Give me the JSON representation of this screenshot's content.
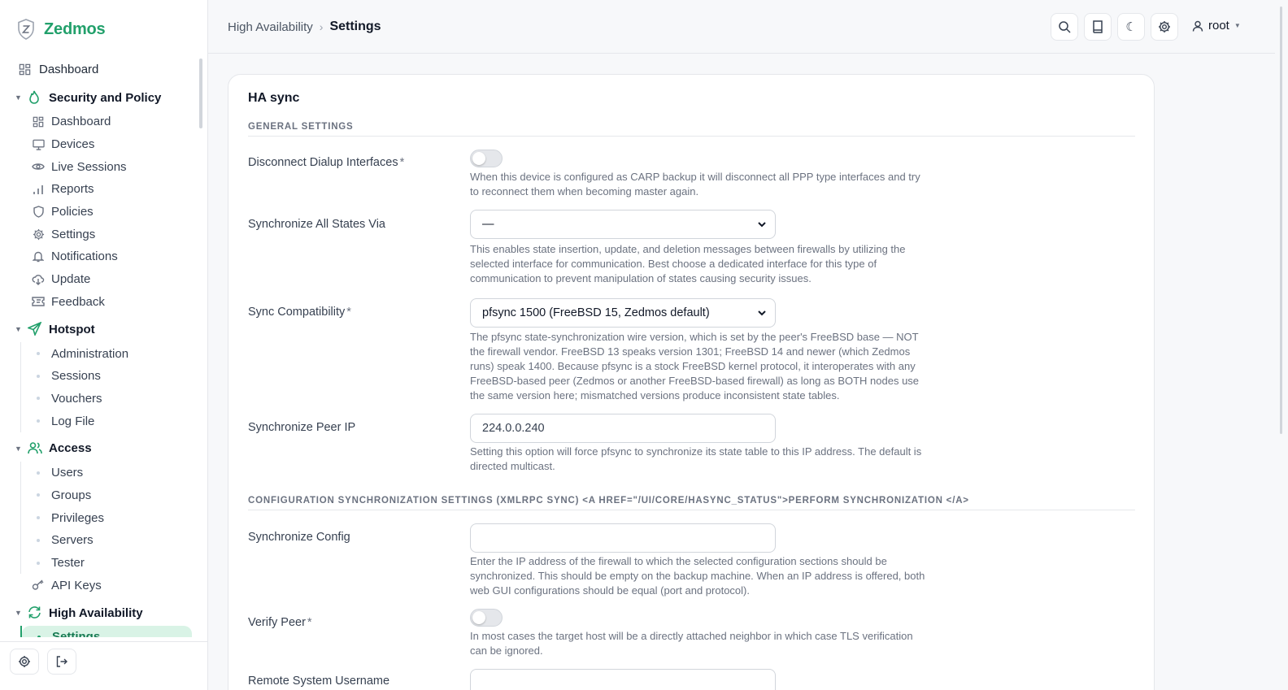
{
  "brand": {
    "name": "Zedmos"
  },
  "sidebar": {
    "top_item": {
      "label": "Dashboard",
      "icon": "grid-icon"
    },
    "groups": [
      {
        "label": "Security and Policy",
        "icon": "flame-icon",
        "items": [
          {
            "label": "Dashboard",
            "icon": "grid-icon"
          },
          {
            "label": "Devices",
            "icon": "monitor-icon"
          },
          {
            "label": "Live Sessions",
            "icon": "eye-icon"
          },
          {
            "label": "Reports",
            "icon": "bar-chart-icon"
          },
          {
            "label": "Policies",
            "icon": "shield-icon"
          },
          {
            "label": "Settings",
            "icon": "gear-icon"
          },
          {
            "label": "Notifications",
            "icon": "bell-icon"
          },
          {
            "label": "Update",
            "icon": "cloud-download-icon"
          },
          {
            "label": "Feedback",
            "icon": "ticket-icon"
          }
        ]
      },
      {
        "label": "Hotspot",
        "icon": "send-icon",
        "items": [
          {
            "label": "Administration"
          },
          {
            "label": "Sessions"
          },
          {
            "label": "Vouchers"
          },
          {
            "label": "Log File"
          }
        ]
      },
      {
        "label": "Access",
        "icon": "users-icon",
        "items": [
          {
            "label": "Users"
          },
          {
            "label": "Groups"
          },
          {
            "label": "Privileges"
          },
          {
            "label": "Servers"
          },
          {
            "label": "Tester"
          },
          {
            "label": "API Keys",
            "icon": "key-icon"
          }
        ]
      },
      {
        "label": "High Availability",
        "icon": "refresh-icon",
        "items": [
          {
            "label": "Settings",
            "active": true
          }
        ]
      }
    ]
  },
  "header": {
    "breadcrumb_parent": "High Availability",
    "breadcrumb_current": "Settings",
    "user": "root"
  },
  "card": {
    "title": "HA sync",
    "general_section": "General Settings",
    "config_section": "Configuration Synchronization Settings (XMLRPC Sync) <a href=\"/ui/core/hasync_status\">Perform synchronization </a>",
    "fields": {
      "disconnect": {
        "label": "Disconnect Dialup Interfaces",
        "required": "*",
        "enabled": false,
        "help": "When this device is configured as CARP backup it will disconnect all PPP type interfaces and try to reconnect them when becoming master again."
      },
      "sync_states": {
        "label": "Synchronize All States Via",
        "value": "—",
        "help": "This enables state insertion, update, and deletion messages between firewalls by utilizing the selected interface for communication. Best choose a dedicated interface for this type of communication to prevent manipulation of states causing security issues."
      },
      "sync_compat": {
        "label": "Sync Compatibility",
        "required": "*",
        "value": "pfsync 1500 (FreeBSD 15, Zedmos default)",
        "help": "The pfsync state-synchronization wire version, which is set by the peer's FreeBSD base — NOT the firewall vendor. FreeBSD 13 speaks version 1301; FreeBSD 14 and newer (which Zedmos runs) speak 1400. Because pfsync is a stock FreeBSD kernel protocol, it interoperates with any FreeBSD-based peer (Zedmos or another FreeBSD-based firewall) as long as BOTH nodes use the same version here; mismatched versions produce inconsistent state tables."
      },
      "peer_ip": {
        "label": "Synchronize Peer IP",
        "value": "224.0.0.240",
        "help": "Setting this option will force pfsync to synchronize its state table to this IP address. The default is directed multicast."
      },
      "sync_config": {
        "label": "Synchronize Config",
        "value": "",
        "help": "Enter the IP address of the firewall to which the selected configuration sections should be synchronized. This should be empty on the backup machine. When an IP address is offered, both web GUI configurations should be equal (port and protocol)."
      },
      "verify_peer": {
        "label": "Verify Peer",
        "required": "*",
        "enabled": false,
        "help": "In most cases the target host will be a directly attached neighbor in which case TLS verification can be ignored."
      },
      "remote_user": {
        "label": "Remote System Username",
        "value": ""
      }
    }
  },
  "colors": {
    "accent": "#22a06b",
    "active_bg": "#d9f3e6"
  }
}
